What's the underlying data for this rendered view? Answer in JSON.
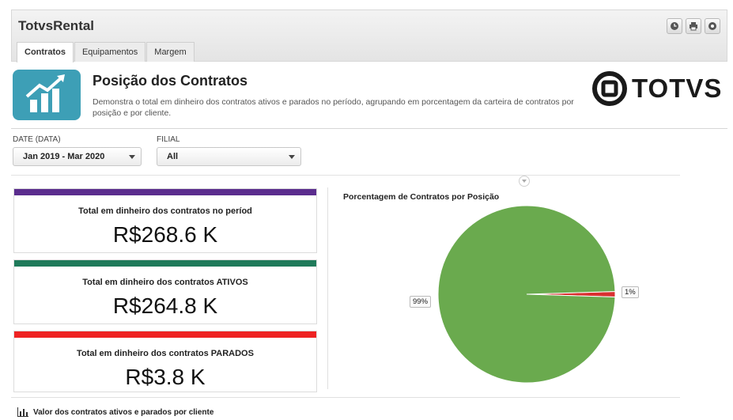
{
  "app": {
    "title": "TotvsRental"
  },
  "top_icons": [
    "clock-icon",
    "print-icon",
    "gear-icon"
  ],
  "tabs": [
    {
      "label": "Contratos",
      "active": true
    },
    {
      "label": "Equipamentos",
      "active": false
    },
    {
      "label": "Margem",
      "active": false
    }
  ],
  "header": {
    "title": "Posição dos Contratos",
    "description": "Demonstra o total em dinheiro dos contratos ativos e parados no período, agrupando em porcentagem da carteira de contratos por posição e por cliente.",
    "brand": "TOTVS"
  },
  "filters": {
    "date": {
      "label": "DATE (DATA)",
      "value": "Jan 2019 - Mar 2020"
    },
    "filial": {
      "label": "FILIAL",
      "value": "All"
    }
  },
  "cards": [
    {
      "label": "Total em dinheiro dos contratos no períod",
      "value": "R$268.6 K",
      "color": "#5b2d8e"
    },
    {
      "label": "Total em dinheiro dos contratos ATIVOS",
      "value": "R$264.8 K",
      "color": "#1f7a5a"
    },
    {
      "label": "Total em dinheiro dos contratos PARADOS",
      "value": "R$3.8 K",
      "color": "#ee2222"
    }
  ],
  "chart_data": {
    "type": "pie",
    "title": "Porcentagem de Contratos por Posição",
    "slices": [
      {
        "value": 99,
        "label": "99%",
        "color": "#6aaa4e"
      },
      {
        "value": 1,
        "label": "1%",
        "color": "#d93030"
      }
    ]
  },
  "footer": {
    "text": "Valor dos contratos ativos e parados por cliente"
  },
  "colors": {
    "accent_tile": "#3d9fb6",
    "pie_active": "#6aaa4e",
    "pie_parados": "#d93030"
  }
}
